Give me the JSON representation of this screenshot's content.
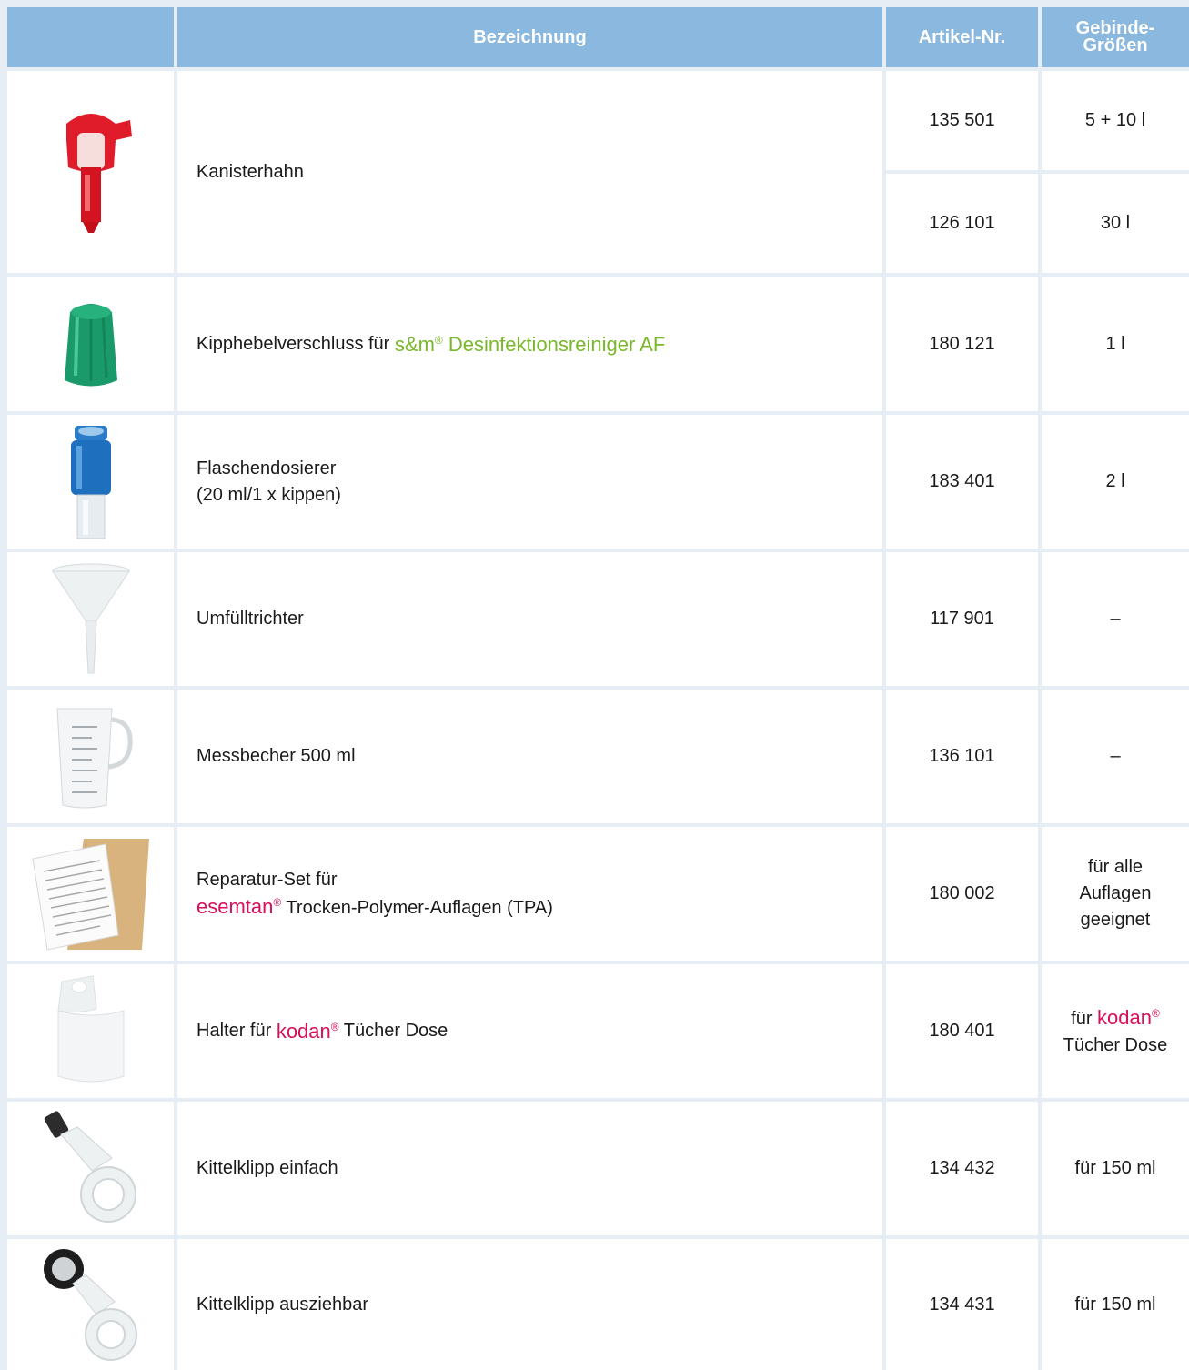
{
  "header": {
    "bezeichnung": "Bezeichnung",
    "artikel_nr": "Artikel-Nr.",
    "gebinde_line1": "Gebinde-",
    "gebinde_line2": "Größen"
  },
  "rows": [
    {
      "icon": "canister-tap-icon",
      "name": "Kanisterhahn",
      "variants": [
        {
          "artikel": "135 501",
          "size": "5 + 10 l"
        },
        {
          "artikel": "126 101",
          "size": "30 l"
        }
      ]
    },
    {
      "icon": "flip-cap-icon",
      "name_prefix": "Kipphebelverschluss für ",
      "brand": "s&m",
      "brand_suffix": " Desinfektionsreiniger AF",
      "reg": "®",
      "artikel": "180 121",
      "size": "1 l",
      "brand_color": "#7ab82b"
    },
    {
      "icon": "bottle-dispenser-icon",
      "name_line1": "Flaschendosierer",
      "name_line2": "(20 ml/1 x kippen)",
      "artikel": "183 401",
      "size": "2 l"
    },
    {
      "icon": "funnel-icon",
      "name": "Umfülltrichter",
      "artikel": "117 901",
      "size": "–"
    },
    {
      "icon": "measuring-cup-icon",
      "name": "Messbecher 500 ml",
      "artikel": "136 101",
      "size": "–"
    },
    {
      "icon": "repair-kit-icon",
      "name_line1": "Reparatur-Set für",
      "brand": "esemtan",
      "reg": "®",
      "name_line2_suffix": " Trocken-Polymer-Auflagen (TPA)",
      "artikel": "180 002",
      "size_line1": "für alle",
      "size_line2": "Auflagen",
      "size_line3": "geeignet",
      "brand_color": "#d6105a"
    },
    {
      "icon": "holder-icon",
      "name_prefix": "Halter für ",
      "brand": "kodan",
      "reg": "®",
      "name_suffix": " Tücher Dose",
      "artikel": "180 401",
      "size_prefix": "für ",
      "size_brand": "kodan",
      "size_line2": "Tücher Dose"
    },
    {
      "icon": "coat-clip-icon",
      "name": "Kittelklipp einfach",
      "artikel": "134 432",
      "size": "für 150 ml"
    },
    {
      "icon": "retractable-clip-icon",
      "name": "Kittelklipp ausziehbar",
      "artikel": "134 431",
      "size": "für 150 ml"
    }
  ]
}
